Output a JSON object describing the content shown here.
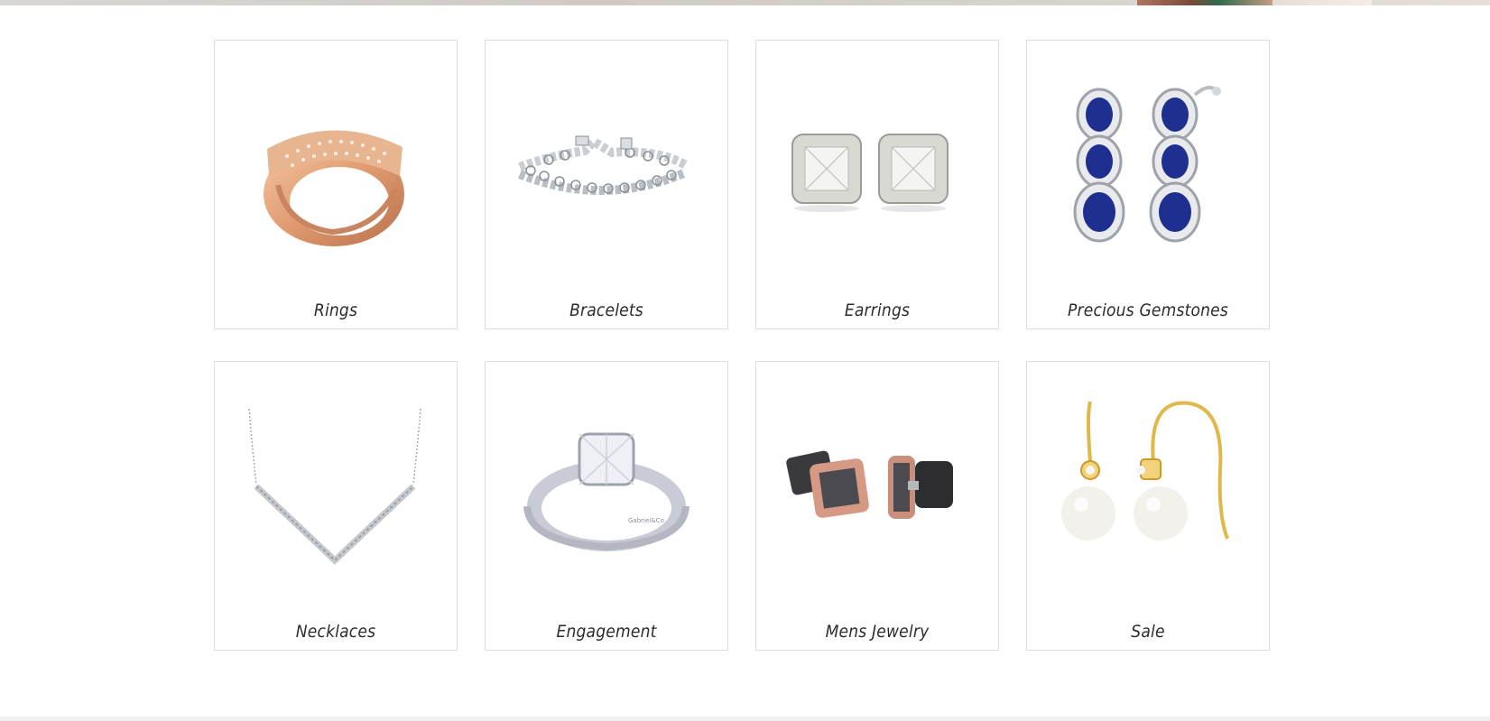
{
  "categories": [
    {
      "label": "Rings",
      "icon": "ring-icon"
    },
    {
      "label": "Bracelets",
      "icon": "bracelet-icon"
    },
    {
      "label": "Earrings",
      "icon": "earrings-icon"
    },
    {
      "label": "Precious Gemstones",
      "icon": "gemstone-earrings-icon"
    },
    {
      "label": "Necklaces",
      "icon": "necklace-icon"
    },
    {
      "label": "Engagement",
      "icon": "engagement-ring-icon"
    },
    {
      "label": "Mens Jewelry",
      "icon": "cufflinks-icon"
    },
    {
      "label": "Sale",
      "icon": "pearl-earrings-icon"
    }
  ],
  "colors": {
    "border": "#dedede",
    "label": "#2b2b2b",
    "rose_gold": "#e0a07c",
    "sapphire": "#1f2f8f",
    "gold": "#e0b84a"
  }
}
